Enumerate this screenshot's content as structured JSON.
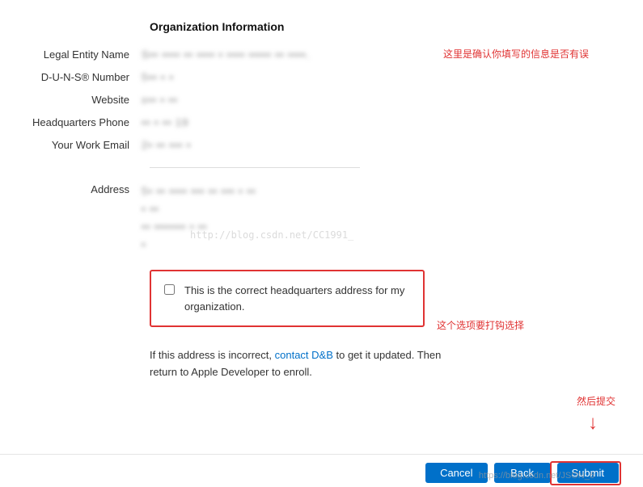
{
  "section_title": "Organization Information",
  "fields": {
    "legal_entity_label": "Legal Entity Name",
    "legal_entity_value": "S▪▪ ▪▪▪▪ ▪▪ ▪▪▪▪ ▪ ▪▪▪▪ ▪▪▪▪▪ ▪▪ ▪▪▪▪.",
    "duns_label": "D-U-N-S® Number",
    "duns_value": "5▪▪ ▪ ▪",
    "website_label": "Website",
    "website_value": "x▪▪ ▪ ▪▪",
    "phone_label": "Headquarters Phone",
    "phone_value": "▪▪ ▪ ▪▪ 19",
    "email_label": "Your Work Email",
    "email_value": "2▪ ▪▪ ▪▪▪ ▪",
    "address_label": "Address",
    "address_value": "5▪ ▪▪ ▪▪▪▪ ▪▪▪ ▪▪ ▪▪▪ ▪ ▪▪\n▪ ▪▪\n▪▪ ▪▪▪▪▪▪▪ ▪ ▪▪\n▪"
  },
  "watermark": "http://blog.csdn.net/CC1991_",
  "checkbox_label": "This is the correct headquarters address for my organization.",
  "help_text_before": "If this address is incorrect, ",
  "help_link": "contact D&B",
  "help_text_after": " to get it updated. Then return to Apple Developer to enroll.",
  "buttons": {
    "cancel": "Cancel",
    "back": "Back",
    "submit": "Submit"
  },
  "annotations": {
    "confirm_info": "这里是确认你填写的信息是否有误",
    "check_option": "这个选项要打钩选择",
    "then_submit": "然后提交"
  },
  "url_overlay": "https://blog.csdn.net/JSON_6"
}
